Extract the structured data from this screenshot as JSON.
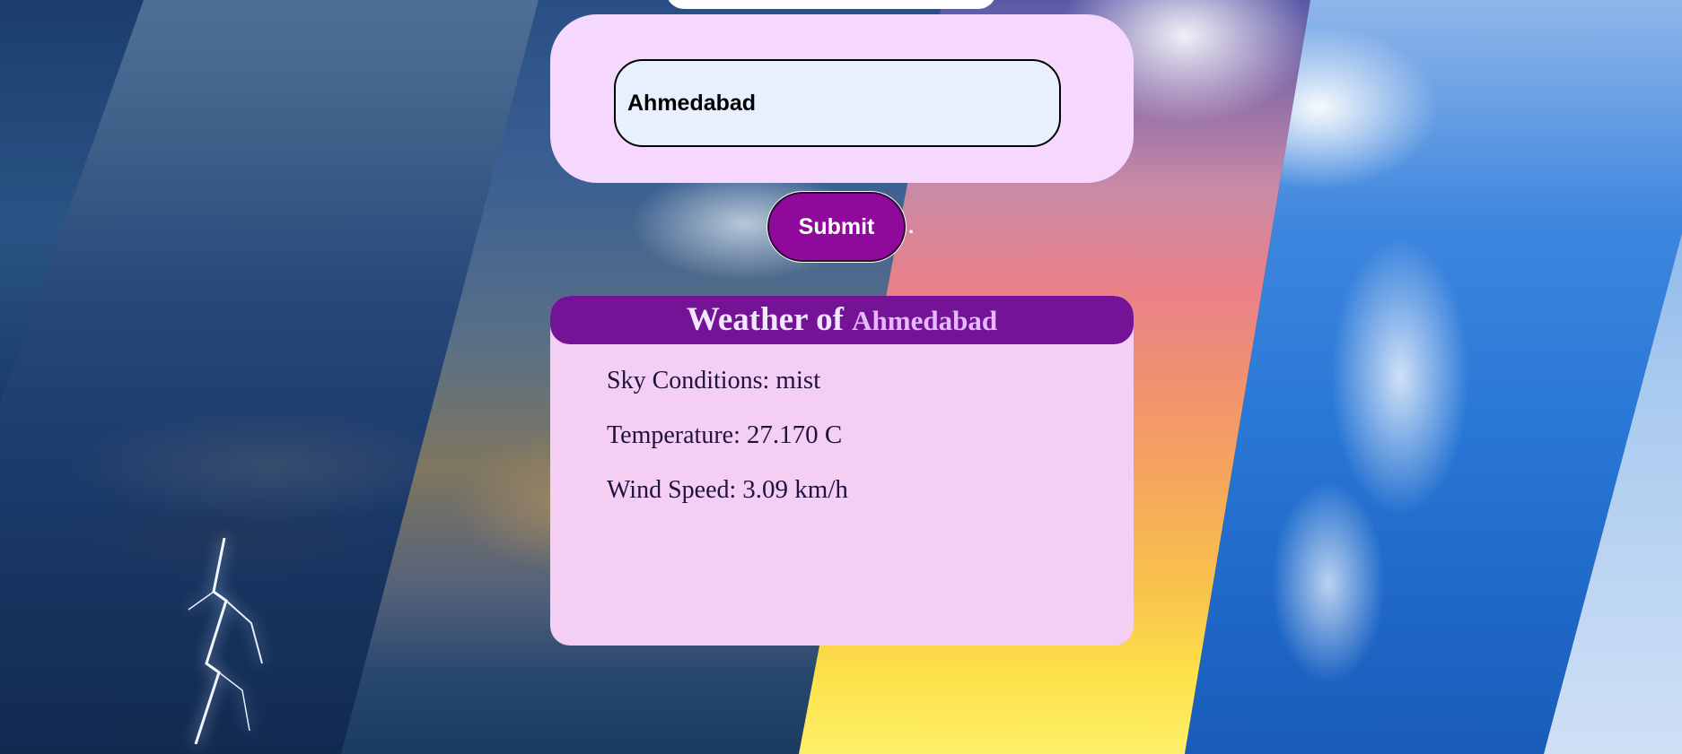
{
  "search": {
    "city_value": "Ahmedabad"
  },
  "submit": {
    "label": "Submit",
    "trailing_text": "."
  },
  "weather": {
    "title_prefix": "Weather of",
    "city": "Ahmedabad",
    "sky_label": "Sky Conditions:",
    "sky_value": "mist",
    "temp_label": "Temperature:",
    "temp_value": "27.170 C",
    "wind_label": "Wind Speed:",
    "wind_value": "3.09 km/h"
  },
  "colors": {
    "card_bg": "#f6d8ff",
    "header_bg": "#751396",
    "button_bg": "#8f0a9b",
    "result_card_bg": "#f5cef3"
  }
}
